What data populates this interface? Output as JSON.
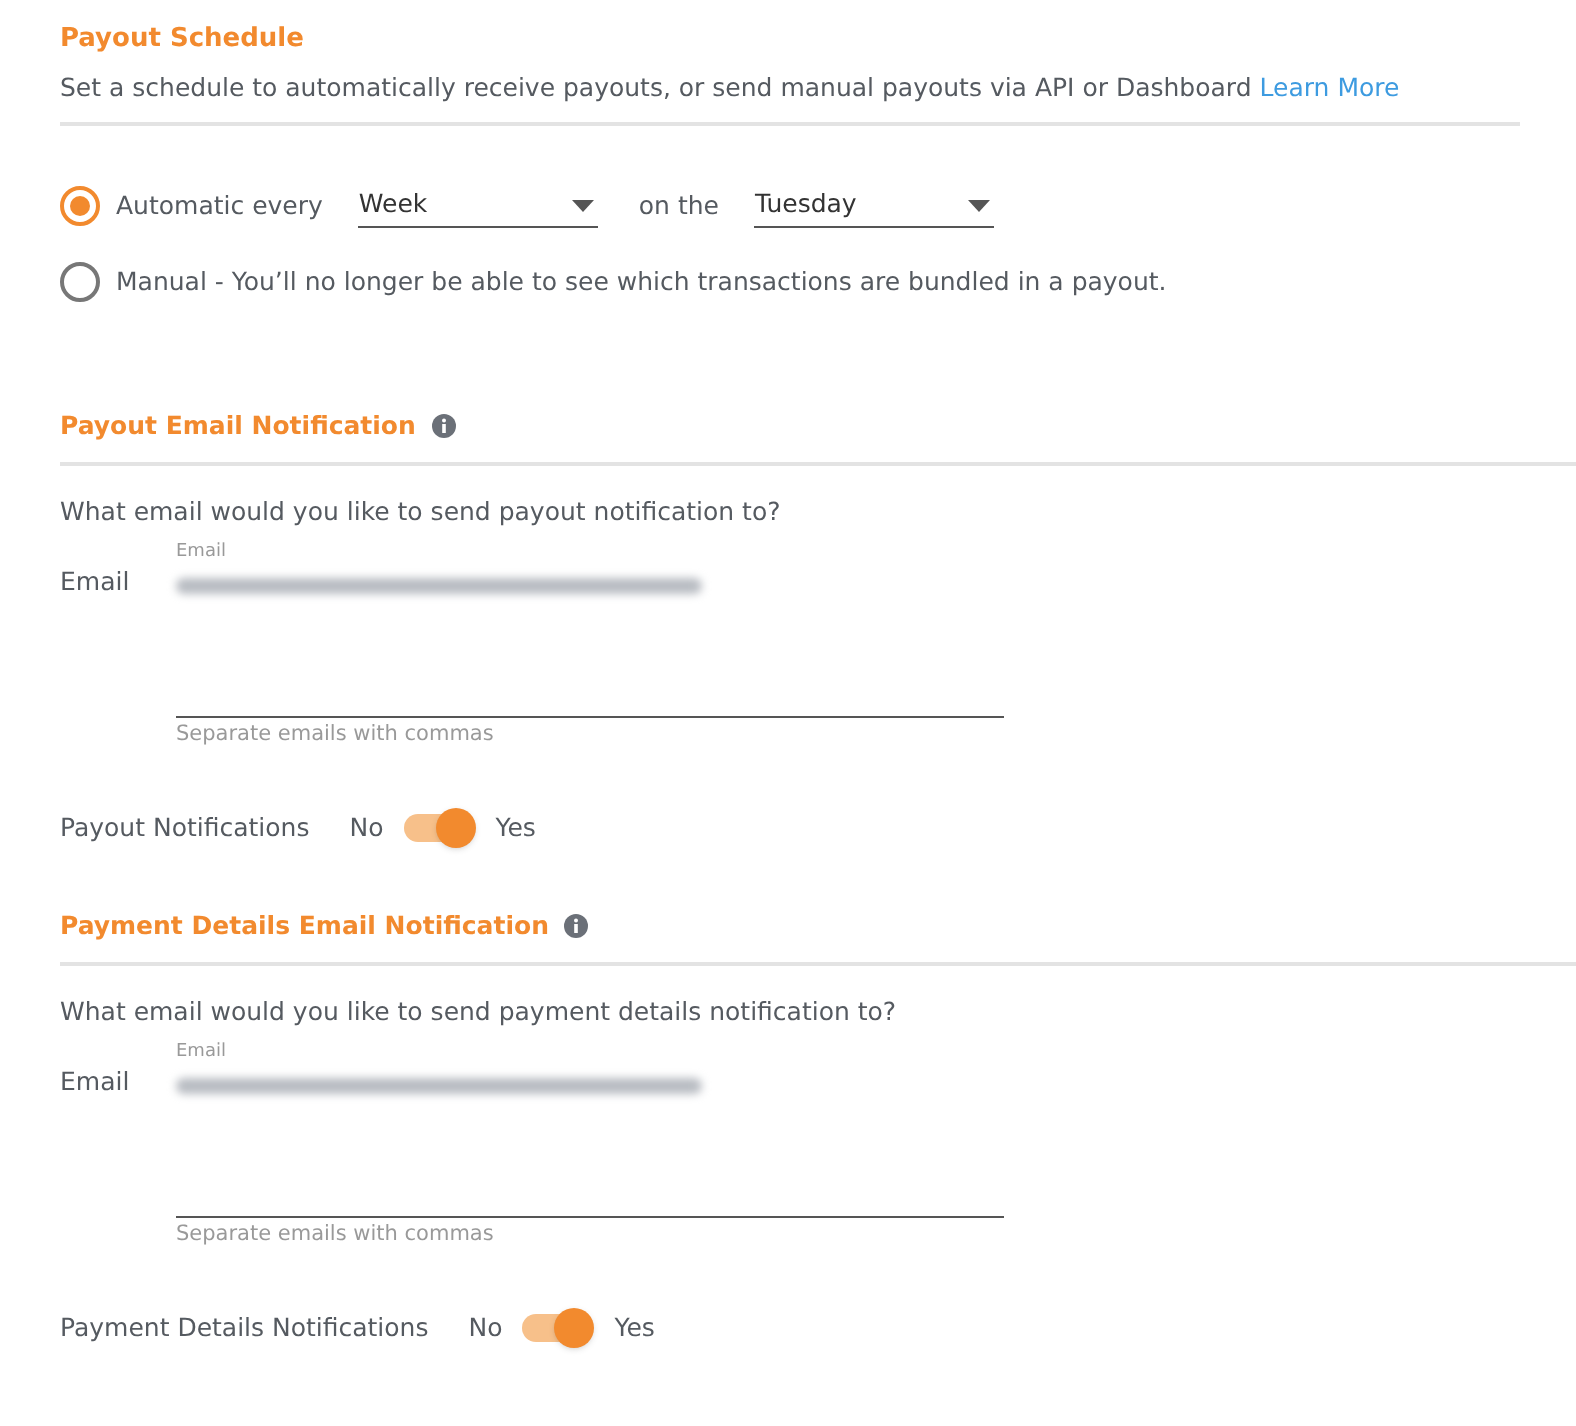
{
  "schedule": {
    "title": "Payout Schedule",
    "description": "Set a schedule to automatically receive payouts, or send manual payouts via API or Dashboard",
    "link": "Learn More",
    "options": [
      {
        "kind": "automatic",
        "label": "Automatic every",
        "selected": true,
        "frequency": "Week",
        "connector": "on the",
        "day": "Tuesday"
      },
      {
        "kind": "manual",
        "label": "Manual - You’ll no longer be able to see which transactions are bundled in a payout.",
        "selected": false
      }
    ]
  },
  "sections": [
    {
      "title": "Payout Email Notification",
      "question": "What email would you like to send payout notification to?",
      "field_label": "Email",
      "floating_label": "Email",
      "hint": "Separate emails with commas",
      "toggle": {
        "label": "Payout Notifications",
        "off_label": "No",
        "on_label": "Yes",
        "on": true
      }
    },
    {
      "title": "Payment Details Email Notification",
      "question": "What email would you like to send payment details notification to?",
      "field_label": "Email",
      "floating_label": "Email",
      "hint": "Separate emails with commas",
      "toggle": {
        "label": "Payment Details Notifications",
        "off_label": "No",
        "on_label": "Yes",
        "on": true
      }
    }
  ]
}
